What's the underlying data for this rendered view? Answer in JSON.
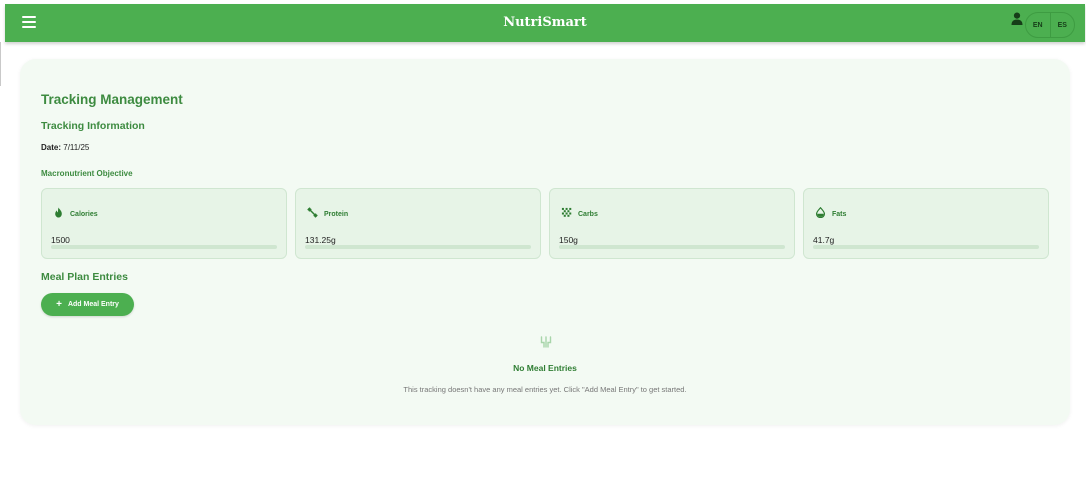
{
  "app": {
    "title": "NutriSmart"
  },
  "header": {
    "menu_icon": "hamburger-menu-icon",
    "user_icon": "user-icon",
    "languages": [
      "EN",
      "ES"
    ],
    "brand_color": "#4caf50"
  },
  "page": {
    "title": "Tracking Management",
    "section_title": "Tracking Information",
    "date_label": "Date:",
    "date_value": "7/11/25",
    "macro_title": "Macronutrient Objective"
  },
  "macros": [
    {
      "label": "Calories",
      "value": "1500",
      "icon": "flame-icon"
    },
    {
      "label": "Protein",
      "value": "131.25g",
      "icon": "dumbbell-icon"
    },
    {
      "label": "Carbs",
      "value": "150g",
      "icon": "grain-icon"
    },
    {
      "label": "Fats",
      "value": "41.7g",
      "icon": "oil-drop-icon"
    }
  ],
  "meals": {
    "title": "Meal Plan Entries",
    "add_button": "Add Meal Entry",
    "empty_icon": "utensils-icon",
    "empty_title": "No Meal Entries",
    "empty_text": "This tracking doesn't have any meal entries yet. Click \"Add Meal Entry\" to get started."
  }
}
